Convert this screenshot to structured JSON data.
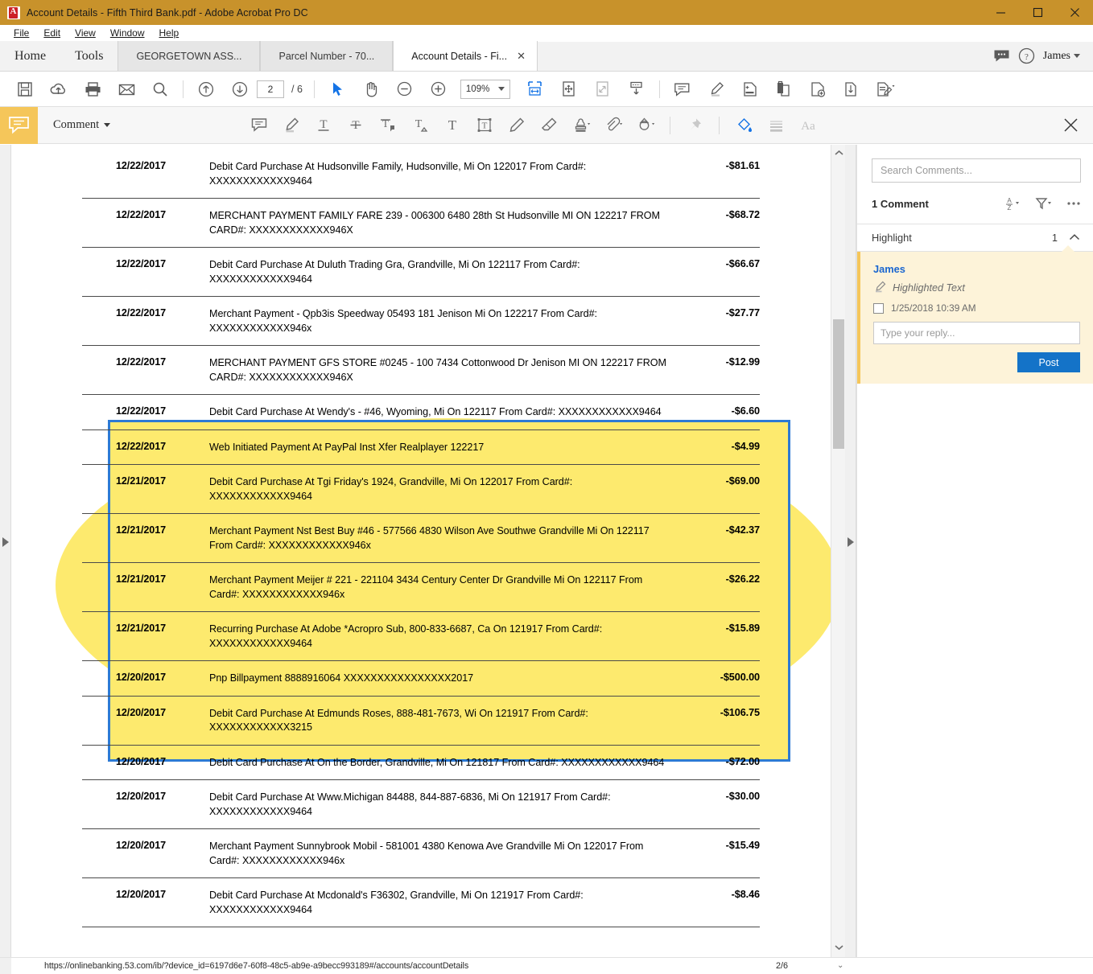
{
  "window": {
    "title": "Account Details - Fifth Third Bank.pdf - Adobe Acrobat Pro DC",
    "app_icon": "adobe-acrobat-icon",
    "minimize": "—",
    "maximize": "□",
    "close": "✕"
  },
  "menubar": {
    "items": [
      "File",
      "Edit",
      "View",
      "Window",
      "Help"
    ]
  },
  "tabstrip": {
    "nav": [
      "Home",
      "Tools"
    ],
    "tabs": [
      {
        "label": "GEORGETOWN ASS...",
        "active": false
      },
      {
        "label": "Parcel Number - 70...",
        "active": false
      },
      {
        "label": "Account Details - Fi...",
        "active": true,
        "close": "✕"
      }
    ],
    "user": "James"
  },
  "toolbar": {
    "page_value": "2",
    "page_total": "/ 6",
    "zoom_value": "109%",
    "icons": [
      "save-icon",
      "upload-cloud-icon",
      "print-icon",
      "email-icon",
      "search-icon",
      "previous-page-icon",
      "next-page-icon",
      "select-cursor-icon",
      "hand-tool-icon",
      "zoom-out-icon",
      "zoom-in-icon",
      "fit-width-icon",
      "pan-page-icon",
      "fit-page-icon",
      "scroll-mode-icon",
      "add-comment-icon",
      "highlight-icon",
      "edit-pdf-icon",
      "export-pdf-icon",
      "create-pdf-icon",
      "combine-files-icon",
      "fill-and-sign-icon"
    ]
  },
  "commentbar": {
    "badge_icon": "comment-balloon-icon",
    "label": "Comment",
    "tools": [
      "sticky-note-icon",
      "highlight-text-icon",
      "underline-text-icon",
      "strikethrough-text-icon",
      "replace-text-icon",
      "insert-text-icon",
      "add-text-icon",
      "text-box-icon",
      "draw-freehand-icon",
      "erase-icon",
      "stamp-icon",
      "attach-file-icon",
      "add-shapes-icon",
      "pin-icon",
      "color-fill-icon",
      "line-thickness-icon",
      "text-properties-icon"
    ],
    "close_icon": "close-icon"
  },
  "comments_panel": {
    "search_placeholder": "Search Comments...",
    "count_label": "1 Comment",
    "sort_icon": "sort-az-icon",
    "filter_icon": "filter-icon",
    "more_icon": "more-options-icon",
    "group": {
      "label": "Highlight",
      "count": "1",
      "collapse_icon": "chevron-up-icon"
    },
    "comment": {
      "author": "James",
      "type_icon": "highlighter-icon",
      "type": "Highlighted Text",
      "timestamp": "1/25/2018  10:39 AM",
      "reply_placeholder": "Type your reply...",
      "post_label": "Post"
    }
  },
  "statusbar": {
    "url": "https://onlinebanking.53.com/ib/?device_id=6197d6e7-60f8-48c5-ab9e-a9becc993189#/accounts/accountDetails",
    "page": "2/6",
    "caret": "⌄"
  },
  "colors": {
    "titlebar": "#c8922b",
    "highlight_yellow": "#fdea6e",
    "selection_blue": "#2d7ad4",
    "accent_blue": "#1473e6",
    "comment_card": "#fdf3d9",
    "comment_accent": "#f5c65a"
  },
  "document": {
    "transactions": [
      {
        "date": "12/22/2017",
        "desc": "Debit Card Purchase At Hudsonville Family, Hudsonville, Mi On 122017 From Card#: XXXXXXXXXXXX9464",
        "amount": "-$81.61"
      },
      {
        "date": "12/22/2017",
        "desc": "MERCHANT PAYMENT FAMILY FARE 239 - 006300 6480 28th St Hudsonville MI ON 122217 FROM CARD#: XXXXXXXXXXXX946X",
        "amount": "-$68.72"
      },
      {
        "date": "12/22/2017",
        "desc": "Debit Card Purchase At Duluth Trading Gra, Grandville, Mi On 122117 From Card#: XXXXXXXXXXXX9464",
        "amount": "-$66.67"
      },
      {
        "date": "12/22/2017",
        "desc": "Merchant Payment - Qpb3is Speedway 05493 181 Jenison Mi On 122217 From Card#: XXXXXXXXXXXX946x",
        "amount": "-$27.77"
      },
      {
        "date": "12/22/2017",
        "desc": "MERCHANT PAYMENT GFS STORE #0245 - 100 7434 Cottonwood Dr Jenison MI ON 122217 FROM CARD#: XXXXXXXXXXXX946X",
        "amount": "-$12.99"
      },
      {
        "date": "12/22/2017",
        "desc": "Debit Card Purchase At Wendy's - #46, Wyoming, Mi On 122117 From Card#: XXXXXXXXXXXX9464",
        "amount": "-$6.60"
      },
      {
        "date": "12/22/2017",
        "desc": "Web Initiated Payment At PayPal Inst Xfer Realplayer 122217",
        "amount": "-$4.99"
      },
      {
        "date": "12/21/2017",
        "desc": "Debit Card Purchase At Tgi Friday's 1924, Grandville, Mi On 122017 From Card#: XXXXXXXXXXXX9464",
        "amount": "-$69.00"
      },
      {
        "date": "12/21/2017",
        "desc": "Merchant Payment Nst Best Buy #46 - 577566 4830 Wilson Ave Southwe Grandville Mi On 122117 From Card#: XXXXXXXXXXXX946x",
        "amount": "-$42.37"
      },
      {
        "date": "12/21/2017",
        "desc": "Merchant Payment Meijer # 221 - 221104 3434 Century Center Dr Grandville Mi On 122117 From Card#: XXXXXXXXXXXX946x",
        "amount": "-$26.22"
      },
      {
        "date": "12/21/2017",
        "desc": "Recurring Purchase At Adobe *Acropro Sub, 800-833-6687, Ca On 121917 From Card#: XXXXXXXXXXXX9464",
        "amount": "-$15.89"
      },
      {
        "date": "12/20/2017",
        "desc": "Pnp Billpayment 8888916064 XXXXXXXXXXXXXXXX2017",
        "amount": "-$500.00"
      },
      {
        "date": "12/20/2017",
        "desc": "Debit Card Purchase At Edmunds Roses, 888-481-7673, Wi On 121917 From Card#: XXXXXXXXXXXX3215",
        "amount": "-$106.75"
      },
      {
        "date": "12/20/2017",
        "desc": "Debit Card Purchase At On the Border, Grandville, Mi On 121817 From Card#: XXXXXXXXXXXX9464",
        "amount": "-$72.00"
      },
      {
        "date": "12/20/2017",
        "desc": "Debit Card Purchase At Www.Michigan 84488, 844-887-6836, Mi On 121917 From Card#: XXXXXXXXXXXX9464",
        "amount": "-$30.00"
      },
      {
        "date": "12/20/2017",
        "desc": "Merchant Payment Sunnybrook Mobil - 581001 4380 Kenowa Ave Grandville Mi On 122017 From Card#: XXXXXXXXXXXX946x",
        "amount": "-$15.49"
      },
      {
        "date": "12/20/2017",
        "desc": "Debit Card Purchase At Mcdonald's F36302, Grandville, Mi On 121917 From Card#: XXXXXXXXXXXX9464",
        "amount": "-$8.46"
      }
    ]
  }
}
